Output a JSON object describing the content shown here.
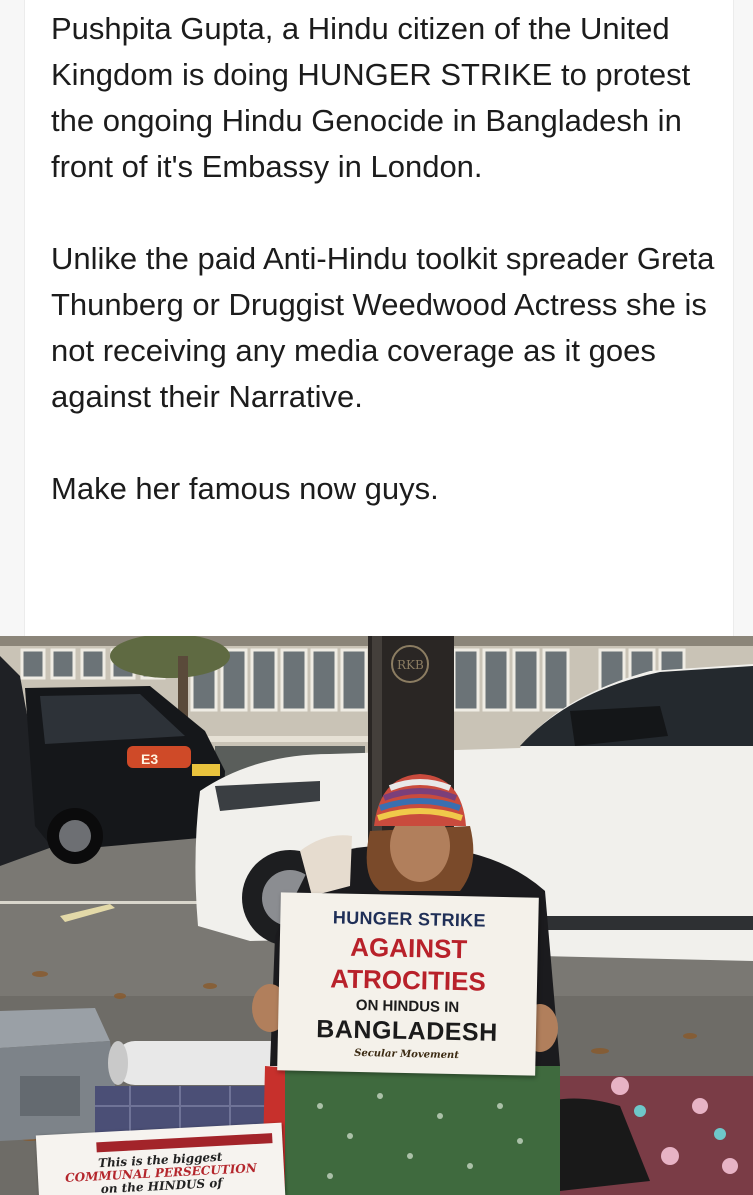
{
  "post": {
    "paragraphs": [
      "Pushpita Gupta, a Hindu citizen of the United Kingdom is doing HUNGER STRIKE to protest the ongoing Hindu Genocide in Bangladesh in front of it's Embassy in London.",
      "Unlike the paid Anti-Hindu toolkit spreader Greta Thunberg  or Druggist Weedwood Actress she is not receiving any media coverage as it goes against their Narrative.",
      "Make her famous now guys."
    ]
  },
  "photo": {
    "placard": {
      "line1": "HUNGER STRIKE",
      "line2": "AGAINST",
      "line3": "ATROCITIES",
      "line4": "ON HINDUS IN",
      "line5": "BANGLADESH",
      "logo_text": "Secular Movement"
    },
    "flyer": {
      "line1": "This is the biggest",
      "line2": "COMMUNAL PERSECUTION",
      "line3": "on the HINDUS of"
    },
    "license_plate_text": "E3",
    "pole_emblem_text": "RKB"
  }
}
